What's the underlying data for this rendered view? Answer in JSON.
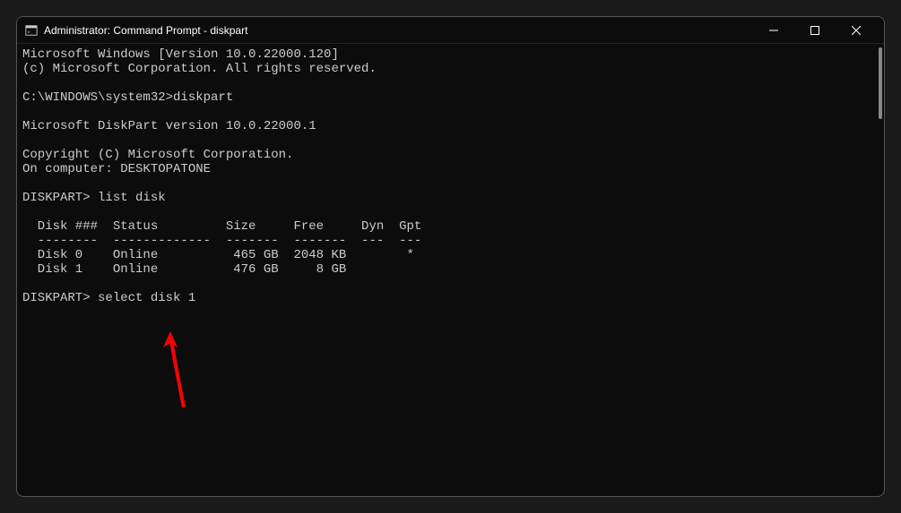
{
  "window": {
    "title": "Administrator: Command Prompt - diskpart"
  },
  "terminal": {
    "lines": [
      "Microsoft Windows [Version 10.0.22000.120]",
      "(c) Microsoft Corporation. All rights reserved.",
      "",
      "C:\\WINDOWS\\system32>diskpart",
      "",
      "Microsoft DiskPart version 10.0.22000.1",
      "",
      "Copyright (C) Microsoft Corporation.",
      "On computer: DESKTOPATONE",
      "",
      "DISKPART> list disk",
      "",
      "  Disk ###  Status         Size     Free     Dyn  Gpt",
      "  --------  -------------  -------  -------  ---  ---",
      "  Disk 0    Online          465 GB  2048 KB        *",
      "  Disk 1    Online          476 GB     8 GB",
      "",
      "DISKPART> select disk 1"
    ],
    "prompt1": "C:\\WINDOWS\\system32>",
    "command1": "diskpart",
    "diskpart_version": "Microsoft DiskPart version 10.0.22000.1",
    "copyright": "Copyright (C) Microsoft Corporation.",
    "computer": "On computer: DESKTOPATONE",
    "prompt2": "DISKPART>",
    "command2": "list disk",
    "table_header": "  Disk ###  Status         Size     Free     Dyn  Gpt",
    "table_divider": "  --------  -------------  -------  -------  ---  ---",
    "disks": [
      {
        "id": "Disk 0",
        "status": "Online",
        "size": "465 GB",
        "free": "2048 KB",
        "dyn": "",
        "gpt": "*"
      },
      {
        "id": "Disk 1",
        "status": "Online",
        "size": "476 GB",
        "free": "8 GB",
        "dyn": "",
        "gpt": ""
      }
    ],
    "command3": "select disk 1"
  }
}
